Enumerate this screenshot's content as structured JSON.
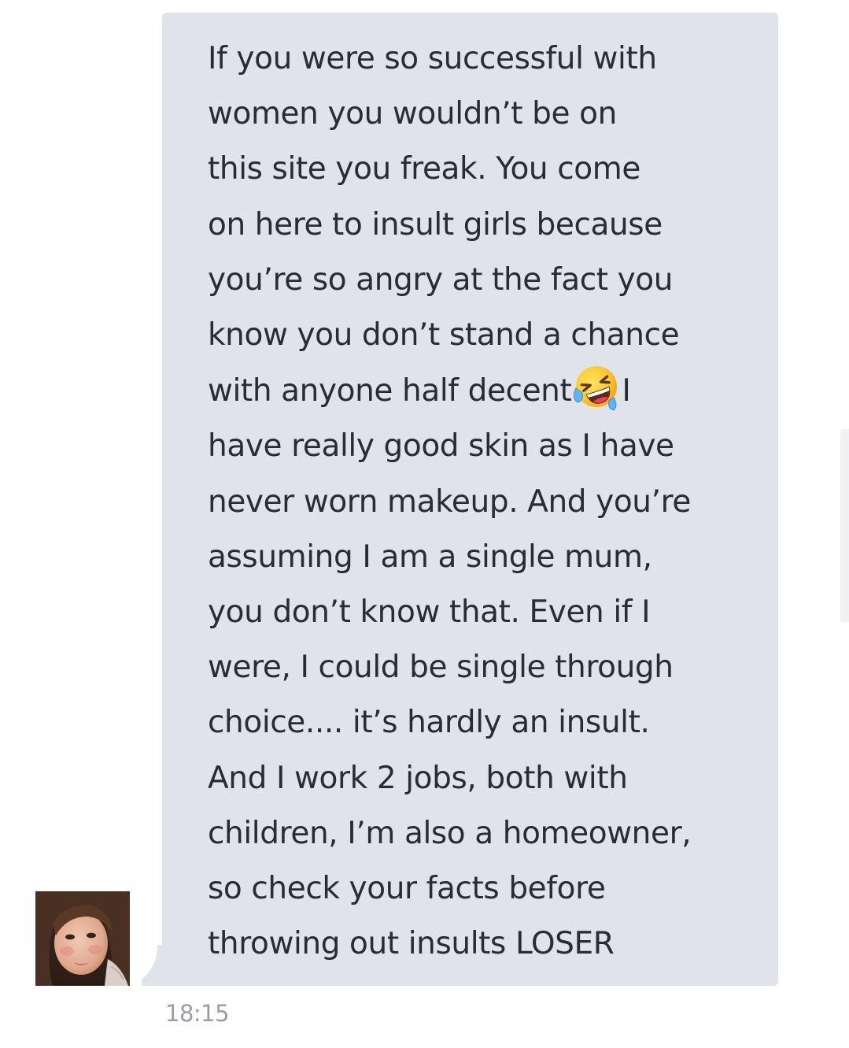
{
  "message": {
    "lines": [
      "If you were so successful with",
      "women you wouldn’t be on",
      "this site you freak. You come",
      "on here to insult girls because",
      "you’re so angry at the fact you",
      "know you don’t stand a chance",
      "with anyone half decent",
      "I",
      "have really good skin as I have",
      "never worn makeup. And you’re",
      "assuming I am a single mum,",
      "you don’t know that. Even if I",
      "were, I could be single through",
      "choice.... it’s hardly an insult.",
      "And I work 2 jobs, both with",
      "children, I’m also a homeowner,",
      "so check your facts before",
      "throwing out insults LOSER"
    ],
    "emoji": "rolling-on-the-floor-laughing",
    "timestamp": "18:15"
  },
  "colors": {
    "bubble_bg": "#e1e3ea",
    "message_text": "#2b2b33",
    "timestamp_text": "#9a9ca6",
    "page_bg": "#ffffff"
  },
  "icons": {
    "emoji": "laughing-tears-emoji-icon",
    "avatar": "sender-avatar-photo"
  }
}
